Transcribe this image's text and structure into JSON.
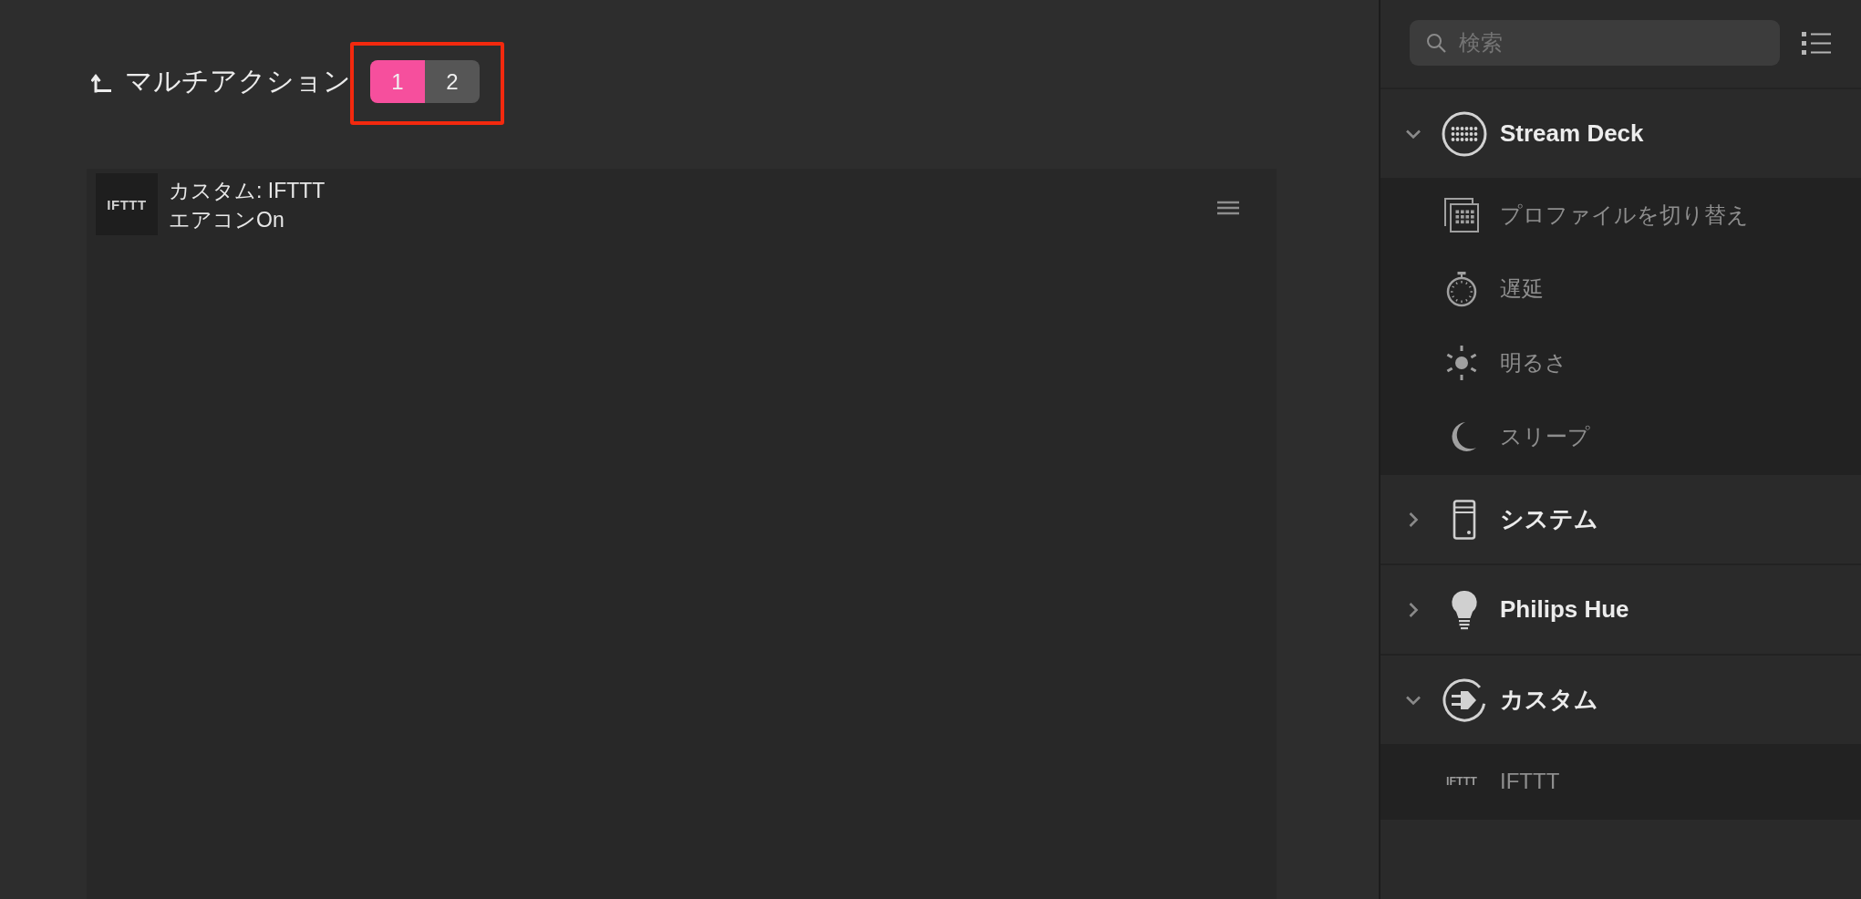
{
  "header": {
    "title": "マルチアクション",
    "steps": [
      {
        "label": "1",
        "selected": true
      },
      {
        "label": "2",
        "selected": false
      }
    ]
  },
  "actions": [
    {
      "logo": "IFTTT",
      "title": "カスタム: IFTTT",
      "subtitle": "エアコンOn"
    }
  ],
  "sidebar": {
    "search": {
      "placeholder": "検索"
    },
    "groups": [
      {
        "name": "Stream Deck",
        "expanded": true,
        "children": [
          {
            "label": "プロファイルを切り替え"
          },
          {
            "label": "遅延"
          },
          {
            "label": "明るさ"
          },
          {
            "label": "スリープ"
          }
        ]
      },
      {
        "name": "システム",
        "expanded": false
      },
      {
        "name": "Philips Hue",
        "expanded": false
      },
      {
        "name": "カスタム",
        "expanded": true,
        "children": [
          {
            "logo": "IFTTT",
            "label": "IFTTT"
          }
        ]
      }
    ]
  }
}
